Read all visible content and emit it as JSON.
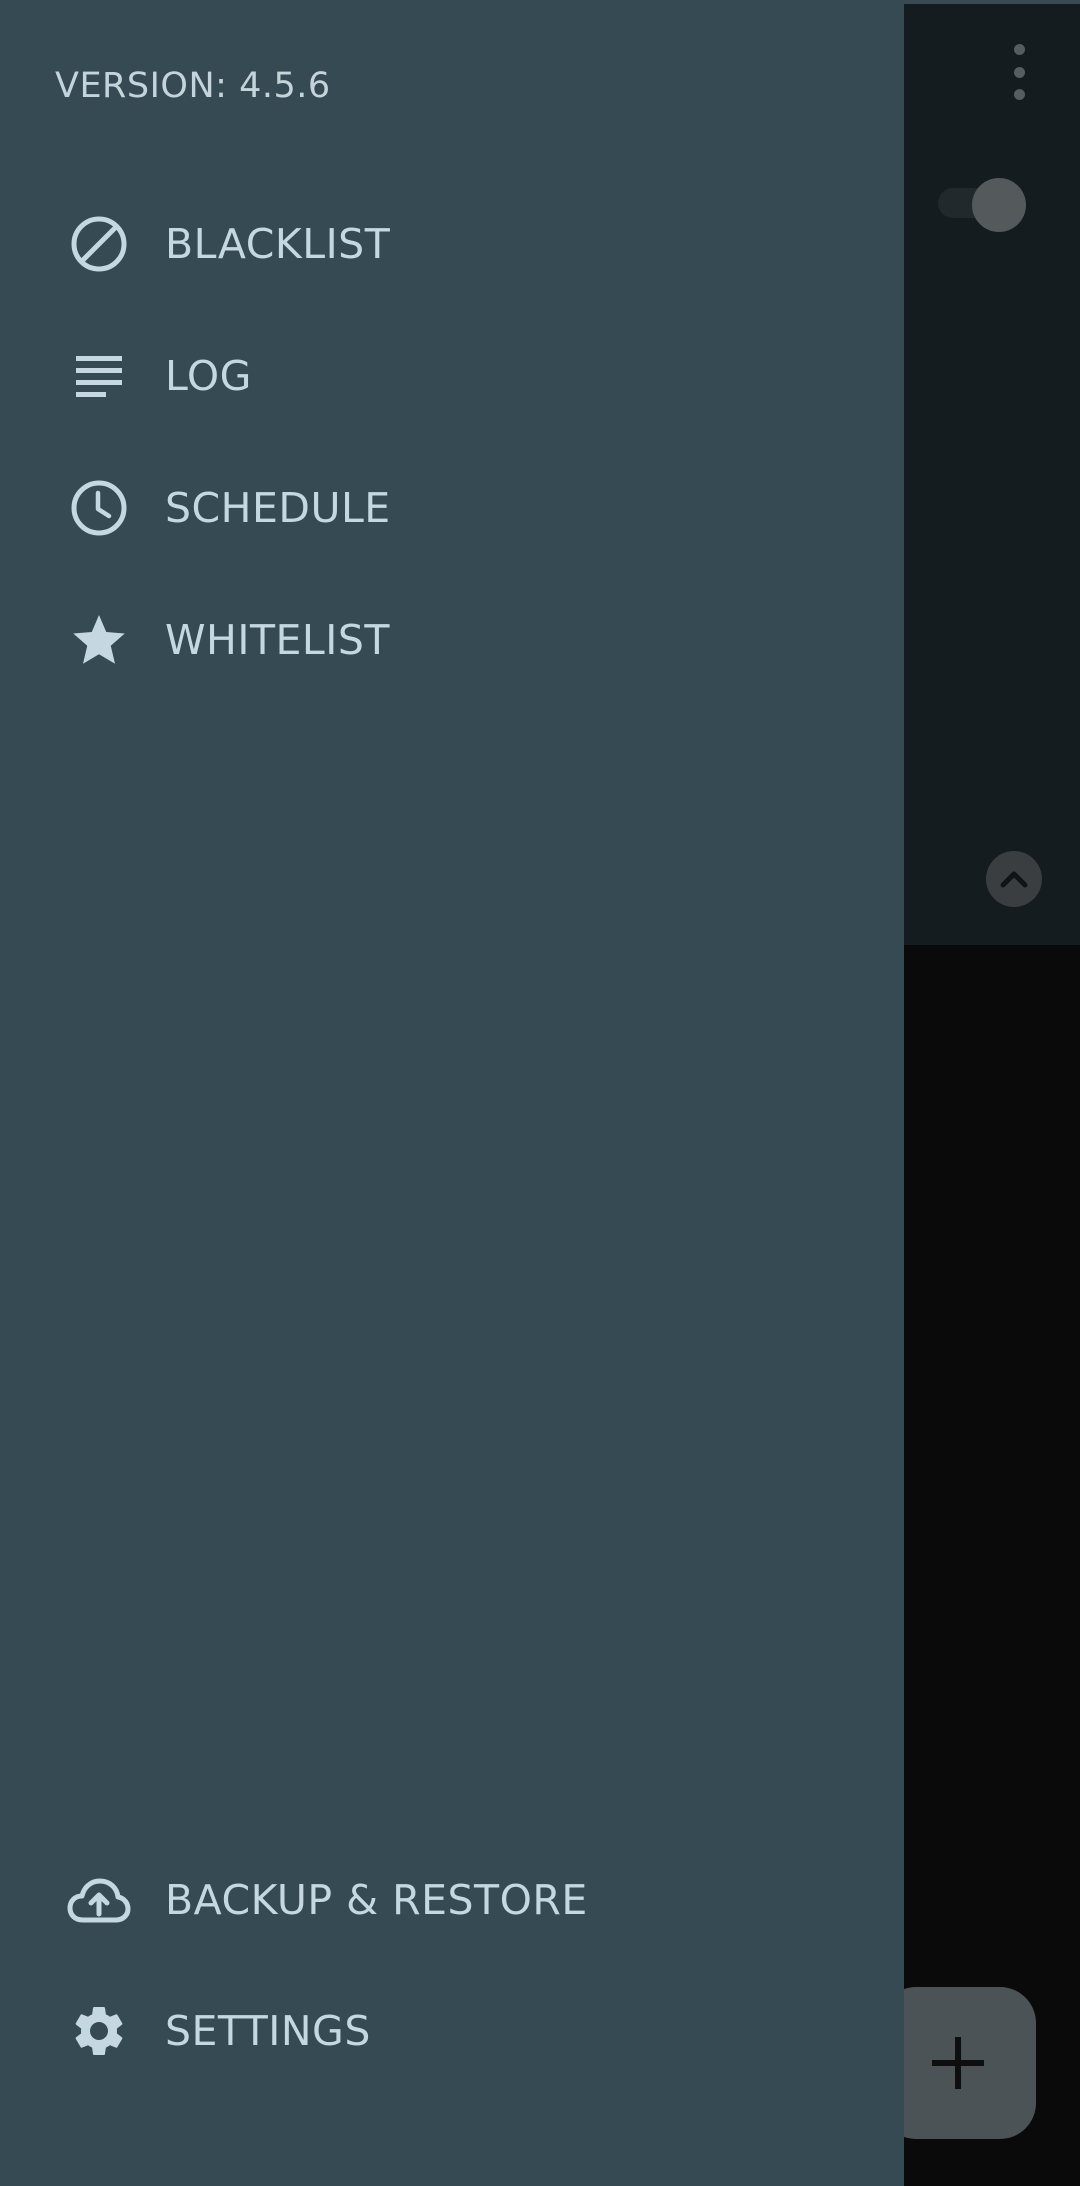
{
  "drawer": {
    "version_text": "VERSION: 4.5.6",
    "menu_items": [
      {
        "label": "BLACKLIST",
        "icon": "block-icon"
      },
      {
        "label": "LOG",
        "icon": "notes-icon"
      },
      {
        "label": "SCHEDULE",
        "icon": "clock-icon"
      },
      {
        "label": "WHITELIST",
        "icon": "star-icon"
      }
    ],
    "bottom_items": [
      {
        "label": "BACKUP & RESTORE",
        "icon": "cloud-upload-icon"
      },
      {
        "label": "SETTINGS",
        "icon": "gear-icon"
      }
    ]
  },
  "background": {
    "overflow_menu_icon": "more-vert-icon",
    "toggle_state": "on",
    "collapse_icon": "chevron-up-icon",
    "fab_icon": "plus-icon"
  },
  "colors": {
    "drawer_bg": "#364a53",
    "text": "#c5d8e2",
    "icon": "#c5d8e2",
    "scrim_header": "#151c1f",
    "scrim_body": "#0a0a0a"
  }
}
